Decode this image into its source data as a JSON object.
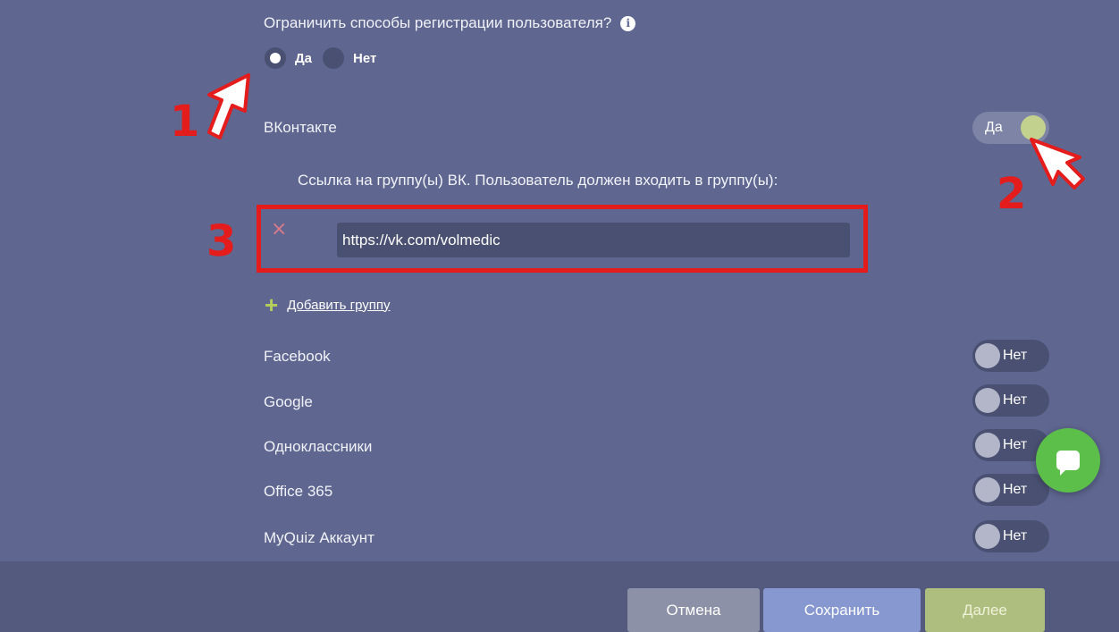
{
  "question": {
    "text": "Ограничить способы регистрации пользователя?",
    "info_glyph": "i",
    "options": [
      "Да",
      "Нет"
    ],
    "selected": "Да"
  },
  "vk": {
    "label": "ВКонтакте",
    "toggle": "Да",
    "hint": "Ссылка на группу(ы) ВК. Пользователь должен входить в группу(ы):",
    "groups": [
      {
        "remove_glyph": "×",
        "url": "https://vk.com/volmedic"
      }
    ],
    "add_plus": "+",
    "add_label": "Добавить группу"
  },
  "providers": [
    {
      "label": "Facebook",
      "toggle": "Нет"
    },
    {
      "label": "Google",
      "toggle": "Нет"
    },
    {
      "label": "Одноклассники",
      "toggle": "Нет"
    },
    {
      "label": "Office 365",
      "toggle": "Нет"
    },
    {
      "label": "MyQuiz Аккаунт",
      "toggle": "Нет"
    }
  ],
  "footer": {
    "cancel": "Отмена",
    "save": "Сохранить",
    "next": "Далее"
  },
  "annotations": [
    "1",
    "2",
    "3"
  ],
  "colors": {
    "background": "#5f6690",
    "toggle_on_knob": "#c3d18e",
    "annotation_red": "#e41c1c",
    "chat_green": "#5cbf4a"
  }
}
